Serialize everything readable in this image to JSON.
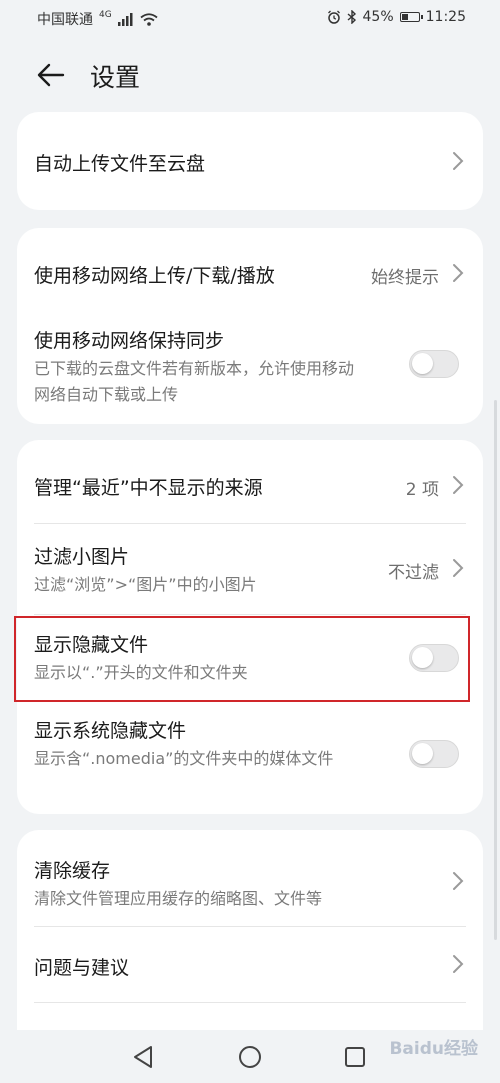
{
  "status_bar": {
    "carrier": "中国联通",
    "network": "4G",
    "alarm_icon": "alarm-icon",
    "bluetooth_icon": "bluetooth-icon",
    "battery_text": "45%",
    "battery_level": 0.45,
    "time": "11:25"
  },
  "header": {
    "title": "设置",
    "back_icon": "arrow-left-icon"
  },
  "sections": {
    "cloud": {
      "auto_upload": "自动上传文件至云盘"
    },
    "mobile": {
      "use_mobile_title": "使用移动网络上传/下载/播放",
      "use_mobile_value": "始终提示",
      "sync_title": "使用移动网络保持同步",
      "sync_desc": "已下载的云盘文件若有新版本，允许使用移动网络自动下载或上传",
      "sync_enabled": false
    },
    "display": {
      "recent_title": "管理“最近”中不显示的来源",
      "recent_value": "2 项",
      "filter_title": "过滤小图片",
      "filter_desc": "过滤“浏览”>“图片”中的小图片",
      "filter_value": "不过滤",
      "hidden_title": "显示隐藏文件",
      "hidden_desc": "显示以“.”开头的文件和文件夹",
      "hidden_enabled": false,
      "sys_hidden_title": "显示系统隐藏文件",
      "sys_hidden_desc": "显示含“.nomedia”的文件夹中的媒体文件",
      "sys_hidden_enabled": false
    },
    "misc": {
      "cache_title": "清除缓存",
      "cache_desc": "清除文件管理应用缓存的缩略图、文件等",
      "feedback_title": "问题与建议"
    }
  },
  "watermark": "Baidu经验",
  "colors": {
    "highlight": "#d0262a",
    "background": "#f1f3f5",
    "card": "#ffffff"
  }
}
